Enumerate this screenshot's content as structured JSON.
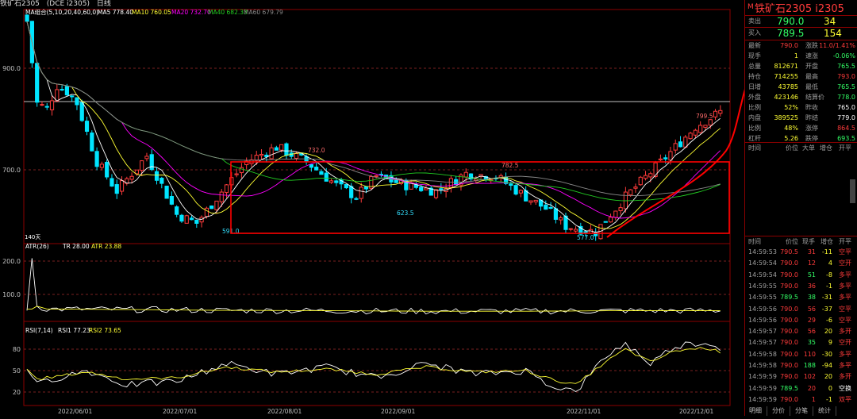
{
  "topbar": {
    "items": [
      "铁矿石2305",
      "(DCE i2305)",
      "日线"
    ]
  },
  "colors": {
    "up": "#ff3b3b",
    "down": "#00e5ff",
    "ma5": "#ffffff",
    "ma10": "#ffff33",
    "ma20": "#ff00ff",
    "ma40": "#22cc22",
    "ma60": "#888888",
    "accent_red": "#ff0000"
  },
  "main_panel": {
    "indicator_label": "MA组合(5,10,20,40,60,0)",
    "ma5": "MA5 778.40",
    "ma10": "MA10 760.05",
    "ma20": "MA20 732.70",
    "ma40": "MA40 682.33",
    "ma60": "MA60 679.79",
    "y_ticks": [
      "900.0",
      "700.0"
    ],
    "days_label": "140天",
    "annotations": [
      "732.0",
      "782.5",
      "623.5",
      "799.5",
      "591.0",
      "577.0"
    ]
  },
  "atr_panel": {
    "label": "ATR(26)",
    "tr": "TR 28.00",
    "atr": "ATR 23.88",
    "y_ticks": [
      "200.0",
      "100.0"
    ]
  },
  "rsi_panel": {
    "label": "RSI(7,14)",
    "rsi1": "RSI1 77.23",
    "rsi2": "RSI2 73.65",
    "y_ticks": [
      "80",
      "50",
      "20"
    ]
  },
  "x_axis": {
    "labels": [
      "2022/06/01",
      "2022/07/01",
      "2022/08/01",
      "2022/09/01",
      "2022/11/01",
      "2022/12/01"
    ]
  },
  "chart_data": {
    "type": "line",
    "ma_values": {
      "MA5": 778.4,
      "MA10": 760.05,
      "MA20": 732.7,
      "MA40": 682.33,
      "MA60": 679.79
    },
    "price_range": [
      560,
      960
    ],
    "price_path_x": [
      0,
      2,
      4,
      6,
      8,
      10,
      14,
      18,
      24,
      30,
      34,
      40,
      44,
      50,
      56,
      62,
      66,
      70,
      76,
      82,
      88,
      94,
      100,
      104,
      108,
      114,
      120,
      126,
      130,
      134,
      140
    ],
    "price_path": [
      940,
      800,
      790,
      830,
      820,
      800,
      700,
      650,
      710,
      610,
      595,
      660,
      700,
      725,
      700,
      660,
      640,
      675,
      660,
      650,
      680,
      675,
      640,
      620,
      590,
      580,
      640,
      690,
      725,
      760,
      790
    ],
    "atr_path_x": [
      0,
      1,
      2,
      4,
      20,
      40,
      60,
      80,
      100,
      120,
      140
    ],
    "atr_path": [
      30,
      210,
      40,
      30,
      28,
      25,
      24,
      22,
      22,
      24,
      24
    ],
    "rsi_x": [
      0,
      2,
      6,
      12,
      20,
      30,
      40,
      50,
      60,
      70,
      80,
      90,
      100,
      105,
      110,
      116,
      120,
      125,
      130,
      136,
      140
    ],
    "rsi1": [
      55,
      30,
      40,
      50,
      30,
      35,
      60,
      45,
      55,
      40,
      60,
      45,
      50,
      30,
      20,
      70,
      88,
      60,
      85,
      90,
      77
    ],
    "rsi2": [
      52,
      38,
      42,
      48,
      38,
      40,
      55,
      48,
      52,
      45,
      55,
      48,
      50,
      38,
      30,
      62,
      80,
      62,
      78,
      82,
      74
    ]
  },
  "quote": {
    "title": "铁矿石2305",
    "code": "i2305",
    "sell_label": "卖出",
    "sell_price": "790.0",
    "sell_vol": "34",
    "buy_label": "买入",
    "buy_price": "789.5",
    "buy_vol": "154",
    "rows": [
      [
        "最新",
        "790.0",
        "涨跌",
        "11.0/1.41%"
      ],
      [
        "现手",
        "1",
        "速涨",
        "-0.06%"
      ],
      [
        "总量",
        "812671",
        "开盘",
        "765.5"
      ],
      [
        "持仓",
        "714255",
        "最高",
        "793.0"
      ],
      [
        "日增",
        "43785",
        "最低",
        "765.5"
      ],
      [
        "外盘",
        "423146",
        "结算价",
        "778.0"
      ],
      [
        "比例",
        "52%",
        "昨收",
        "765.0"
      ],
      [
        "内盘",
        "389525",
        "昨结",
        "779.0"
      ],
      [
        "比例",
        "48%",
        "涨停",
        "864.5"
      ],
      [
        "杠杆",
        "5.26",
        "跌停",
        "693.5"
      ]
    ],
    "list_header": [
      "时间",
      "价位",
      "大单",
      "增仓",
      "开平"
    ],
    "ticks_header": [
      "时间",
      "价位",
      "现手",
      "增仓",
      "开平"
    ],
    "ticks": [
      [
        "14:59:53",
        "790.5",
        "31",
        "-11",
        "空平"
      ],
      [
        "14:59:54",
        "790.0",
        "12",
        "4",
        "空开"
      ],
      [
        "14:59:54",
        "790.0",
        "51",
        "-8",
        "多平"
      ],
      [
        "14:59:55",
        "790.0",
        "36",
        "-1",
        "多平"
      ],
      [
        "14:59:55",
        "789.5",
        "38",
        "-31",
        "多平"
      ],
      [
        "14:59:56",
        "790.0",
        "56",
        "-37",
        "空平"
      ],
      [
        "14:59:56",
        "790.0",
        "29",
        "-6",
        "空平"
      ],
      [
        "14:59:57",
        "790.0",
        "56",
        "20",
        "多开"
      ],
      [
        "14:59:57",
        "790.0",
        "35",
        "9",
        "空开"
      ],
      [
        "14:59:58",
        "790.0",
        "110",
        "-30",
        "多平"
      ],
      [
        "14:59:58",
        "790.0",
        "188",
        "-94",
        "多平"
      ],
      [
        "14:59:59",
        "790.0",
        "102",
        "20",
        "多开"
      ],
      [
        "14:59:59",
        "789.5",
        "20",
        "0",
        "空换"
      ],
      [
        "14:59:59",
        "790.0",
        "1",
        "-1",
        "双平"
      ]
    ]
  },
  "bottom_tabs": [
    "明细",
    "分价",
    "分笔",
    "统计"
  ]
}
